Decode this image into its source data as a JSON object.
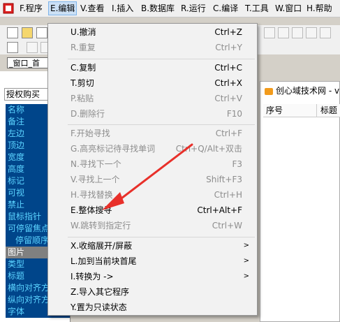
{
  "menubar": {
    "items": [
      {
        "label": "F.程序",
        "active": false
      },
      {
        "label": "E.编辑",
        "active": true
      },
      {
        "label": "V.查看",
        "active": false
      },
      {
        "label": "I.插入",
        "active": false
      },
      {
        "label": "B.数据库",
        "active": false
      },
      {
        "label": "R.运行",
        "active": false
      },
      {
        "label": "C.编译",
        "active": false
      },
      {
        "label": "T.工具",
        "active": false
      },
      {
        "label": "W.窗口",
        "active": false
      },
      {
        "label": "H.帮助",
        "active": false
      }
    ]
  },
  "doc_tab": "_窗口_首",
  "left_panel": {
    "header": "授权购买",
    "props": [
      "名称",
      "备注",
      "左边",
      "顶边",
      "宽度",
      "高度",
      "标记",
      "可视",
      "禁止",
      "鼠标指针",
      "可停留焦点",
      "停留顺序",
      "图片",
      "类型",
      "标题",
      "横向对齐方",
      "纵向对齐方",
      "字体"
    ]
  },
  "right_window": {
    "title": "创心域技术网 - v",
    "columns": [
      "序号",
      "标题"
    ]
  },
  "edit_menu": {
    "items": [
      {
        "label": "U.撤消",
        "shortcut": "Ctrl+Z",
        "disabled": false
      },
      {
        "label": "R.重复",
        "shortcut": "Ctrl+Y",
        "disabled": true
      },
      {
        "label": "C.复制",
        "shortcut": "Ctrl+C",
        "disabled": false
      },
      {
        "label": "T.剪切",
        "shortcut": "Ctrl+X",
        "disabled": false
      },
      {
        "label": "P.粘贴",
        "shortcut": "Ctrl+V",
        "disabled": true
      },
      {
        "label": "D.删除行",
        "shortcut": "F10",
        "disabled": true
      },
      {
        "label": "F.开始寻找",
        "shortcut": "Ctrl+F",
        "disabled": true
      },
      {
        "label": "G.高亮标记待寻找单词",
        "shortcut": "Ctrl+Q/Alt+双击",
        "disabled": true
      },
      {
        "label": "N.寻找下一个",
        "shortcut": "F3",
        "disabled": true
      },
      {
        "label": "V.寻找上一个",
        "shortcut": "Shift+F3",
        "disabled": true
      },
      {
        "label": "H.寻找替换",
        "shortcut": "Ctrl+H",
        "disabled": true
      },
      {
        "label": "E.整体搜寻",
        "shortcut": "Ctrl+Alt+F",
        "disabled": false
      },
      {
        "label": "W.跳转到指定行",
        "shortcut": "Ctrl+W",
        "disabled": true
      },
      {
        "label": "X.收缩展开/屏蔽",
        "shortcut": "",
        "disabled": false,
        "submenu": true
      },
      {
        "label": "L.加到当前块首尾",
        "shortcut": "",
        "disabled": false,
        "submenu": true
      },
      {
        "label": "I.转换为 ->",
        "shortcut": "",
        "disabled": false,
        "submenu": true
      },
      {
        "label": "Z.导入其它程序",
        "shortcut": "",
        "disabled": false
      },
      {
        "label": "Y.置为只读状态",
        "shortcut": "",
        "disabled": false
      }
    ]
  },
  "colors": {
    "accent_blue": "#00458a",
    "annotation_red": "#e8302a"
  }
}
